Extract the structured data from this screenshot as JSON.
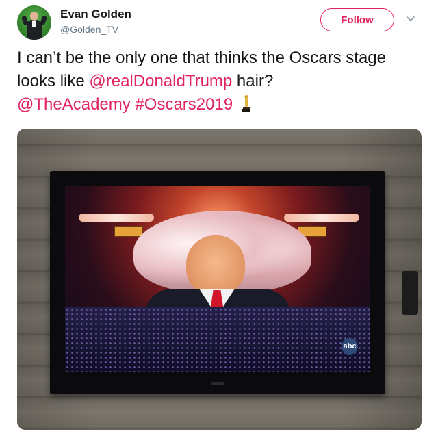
{
  "user": {
    "display_name": "Evan Golden",
    "handle": "@Golden_TV"
  },
  "follow_button": {
    "label": "Follow"
  },
  "tweet": {
    "text_part1": "I can’t be the only one that thinks the Oscars stage looks like ",
    "mention_1": "@realDonaldTrump",
    "text_part2": " hair?",
    "mention_2": "@TheAcademy",
    "hashtag": "#Oscars2019",
    "emoji": "oscar-trophy"
  },
  "media": {
    "network_logo": "abc"
  },
  "colors": {
    "accent": "#e0245e",
    "text": "#14171a",
    "secondary_text": "#657786"
  },
  "icons": {
    "caret": "chevron-down-icon",
    "trophy": "trophy-icon"
  }
}
